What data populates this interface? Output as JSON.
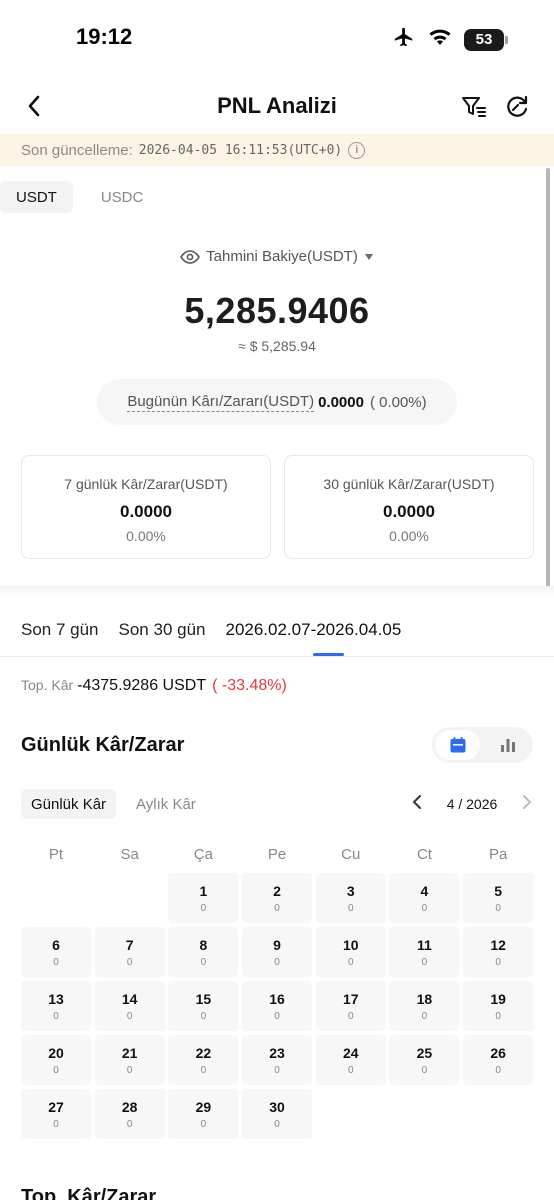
{
  "status_bar": {
    "time": "19:12",
    "battery": "53"
  },
  "nav": {
    "title": "PNL Analizi"
  },
  "update": {
    "label": "Son güncelleme:",
    "value": "2026-04-05 16:11:53(UTC+0)"
  },
  "currency_tabs": [
    {
      "label": "USDT"
    },
    {
      "label": "USDC"
    }
  ],
  "balance": {
    "label": "Tahmini Bakiye(USDT)",
    "value": "5,285.9406",
    "usd": "≈ $ 5,285.94"
  },
  "today": {
    "label": "Bugünün Kârı/Zararı(USDT)",
    "value": "0.0000",
    "pct": "( 0.00%)"
  },
  "stats": [
    {
      "title": "7 günlük Kâr/Zarar(USDT)",
      "value": "0.0000",
      "pct": "0.00%"
    },
    {
      "title": "30 günlük Kâr/Zarar(USDT)",
      "value": "0.0000",
      "pct": "0.00%"
    }
  ],
  "period_tabs": [
    {
      "label": "Son 7 gün"
    },
    {
      "label": "Son 30 gün"
    },
    {
      "label": "2026.02.07-2026.04.05"
    }
  ],
  "total": {
    "label": "Top. Kâr",
    "value": "-4375.9286 USDT",
    "pct": "( -33.48%)"
  },
  "daily": {
    "title": "Günlük Kâr/Zarar"
  },
  "sub_tabs": [
    {
      "label": "Günlük Kâr"
    },
    {
      "label": "Aylık Kâr"
    }
  ],
  "month": {
    "label": "4 / 2026"
  },
  "weekdays": [
    "Pt",
    "Sa",
    "Ça",
    "Pe",
    "Cu",
    "Ct",
    "Pa"
  ],
  "days": [
    {
      "d": "1",
      "v": "0"
    },
    {
      "d": "2",
      "v": "0"
    },
    {
      "d": "3",
      "v": "0"
    },
    {
      "d": "4",
      "v": "0"
    },
    {
      "d": "5",
      "v": "0"
    },
    {
      "d": "6",
      "v": "0"
    },
    {
      "d": "7",
      "v": "0"
    },
    {
      "d": "8",
      "v": "0"
    },
    {
      "d": "9",
      "v": "0"
    },
    {
      "d": "10",
      "v": "0"
    },
    {
      "d": "11",
      "v": "0"
    },
    {
      "d": "12",
      "v": "0"
    },
    {
      "d": "13",
      "v": "0"
    },
    {
      "d": "14",
      "v": "0"
    },
    {
      "d": "15",
      "v": "0"
    },
    {
      "d": "16",
      "v": "0"
    },
    {
      "d": "17",
      "v": "0"
    },
    {
      "d": "18",
      "v": "0"
    },
    {
      "d": "19",
      "v": "0"
    },
    {
      "d": "20",
      "v": "0"
    },
    {
      "d": "21",
      "v": "0"
    },
    {
      "d": "22",
      "v": "0"
    },
    {
      "d": "23",
      "v": "0"
    },
    {
      "d": "24",
      "v": "0"
    },
    {
      "d": "25",
      "v": "0"
    },
    {
      "d": "26",
      "v": "0"
    },
    {
      "d": "27",
      "v": "0"
    },
    {
      "d": "28",
      "v": "0"
    },
    {
      "d": "29",
      "v": "0"
    },
    {
      "d": "30",
      "v": "0"
    }
  ],
  "bottom": {
    "title": "Top. Kâr/Zarar"
  },
  "colors": {
    "accent": "#2b6cf0",
    "negative": "#e5393f",
    "banner": "#fdf4e6"
  }
}
